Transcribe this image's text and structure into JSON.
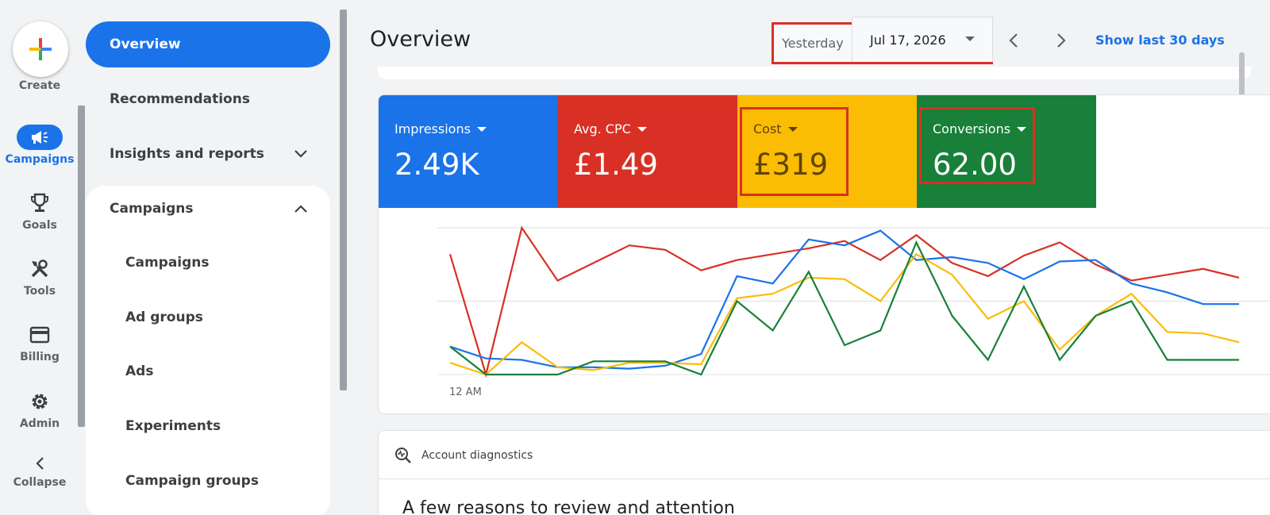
{
  "rail": {
    "create_label": "Create",
    "items": [
      {
        "label": "Campaigns",
        "icon": "megaphone-icon",
        "active": true
      },
      {
        "label": "Goals",
        "icon": "trophy-icon"
      },
      {
        "label": "Tools",
        "icon": "tools-icon"
      },
      {
        "label": "Billing",
        "icon": "credit-card-icon"
      },
      {
        "label": "Admin",
        "icon": "gear-icon"
      },
      {
        "label": "Collapse",
        "icon": "chevron-left-icon"
      }
    ]
  },
  "nav": {
    "overview": "Overview",
    "recommendations": "Recommendations",
    "insights": "Insights and reports",
    "campaigns_section": "Campaigns",
    "sub_items": [
      "Campaigns",
      "Ad groups",
      "Ads",
      "Experiments",
      "Campaign groups"
    ]
  },
  "header": {
    "title": "Overview",
    "date_preset": "Yesterday",
    "date_value": "Jul 17, 2026",
    "show_last": "Show last 30 days"
  },
  "metrics": [
    {
      "label": "Impressions",
      "value": "2.49K",
      "color": "#1a73e8"
    },
    {
      "label": "Avg. CPC",
      "value": "£1.49",
      "color": "#d93025"
    },
    {
      "label": "Cost",
      "value": "£319",
      "color": "#fbbc04"
    },
    {
      "label": "Conversions",
      "value": "62.00",
      "color": "#188038"
    }
  ],
  "chart_data": {
    "type": "line",
    "x_start_label": "12 AM",
    "y_ticks_shown": false,
    "grid": true,
    "series": [
      {
        "color": "#d93025",
        "values": [
          82,
          0,
          100,
          64,
          76,
          88,
          85,
          71,
          78,
          82,
          86,
          91,
          78,
          95,
          76,
          67,
          81,
          90,
          75,
          64,
          68,
          72,
          66
        ]
      },
      {
        "color": "#1a73e8",
        "values": [
          19,
          11,
          10,
          5,
          5,
          4,
          6,
          14,
          67,
          62,
          92,
          88,
          98,
          78,
          80,
          76,
          65,
          77,
          78,
          62,
          56,
          48,
          48
        ]
      },
      {
        "color": "#fbbc04",
        "values": [
          8,
          0,
          22,
          5,
          3,
          8,
          8,
          7,
          52,
          55,
          66,
          65,
          50,
          82,
          68,
          38,
          50,
          17,
          40,
          55,
          29,
          28,
          22
        ]
      },
      {
        "color": "#188038",
        "values": [
          19,
          0,
          0,
          0,
          9,
          9,
          9,
          0,
          50,
          30,
          70,
          20,
          30,
          90,
          40,
          10,
          60,
          10,
          40,
          50,
          10,
          10,
          10
        ]
      }
    ]
  },
  "diagnostics": {
    "title": "Account diagnostics",
    "text": "A few reasons to review and attention"
  }
}
